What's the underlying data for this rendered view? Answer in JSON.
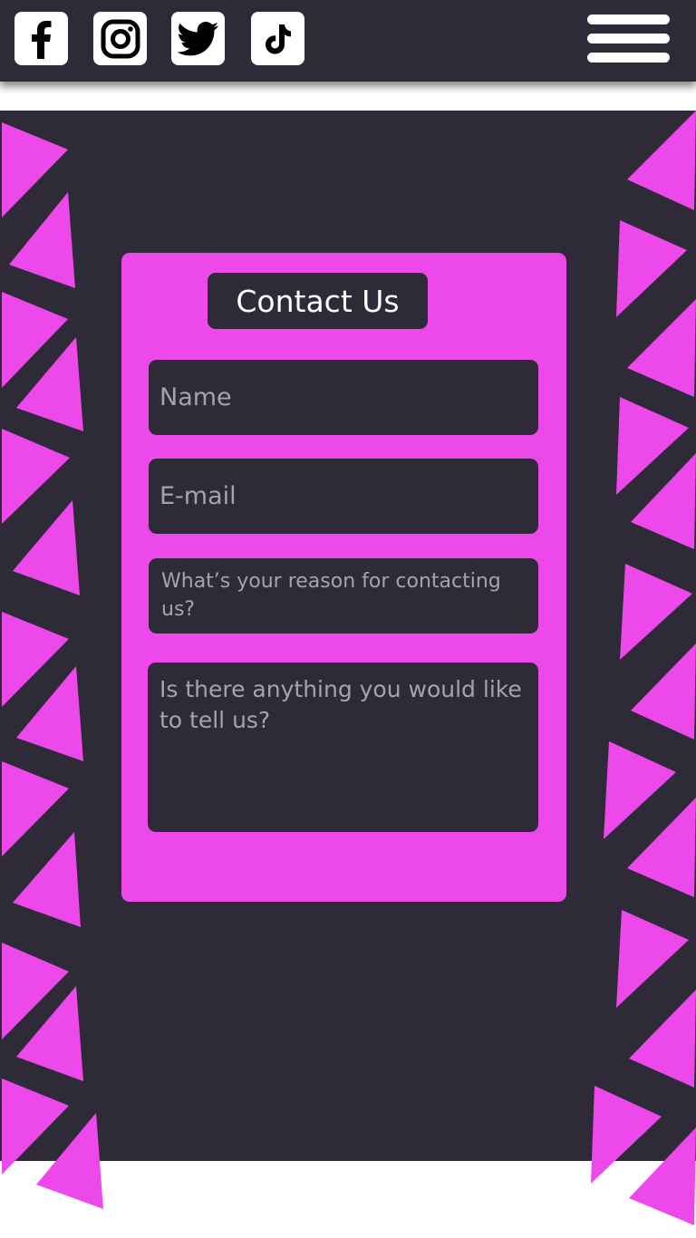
{
  "header": {
    "social_icons": [
      {
        "name": "facebook-icon"
      },
      {
        "name": "instagram-icon"
      },
      {
        "name": "twitter-icon"
      },
      {
        "name": "tiktok-icon"
      }
    ],
    "menu_icon": "hamburger-menu-icon"
  },
  "contact_form": {
    "title": "Contact Us",
    "name_placeholder": "Name",
    "email_placeholder": "E-mail",
    "reason_placeholder": "What’s your reason for contacting us?",
    "message_placeholder": "Is there anything you would like to tell us?"
  },
  "colors": {
    "background_dark": "#2e2a38",
    "accent_pink": "#ec48ea",
    "icon_white": "#ffffff",
    "placeholder_gray": "#a7a3ad"
  }
}
